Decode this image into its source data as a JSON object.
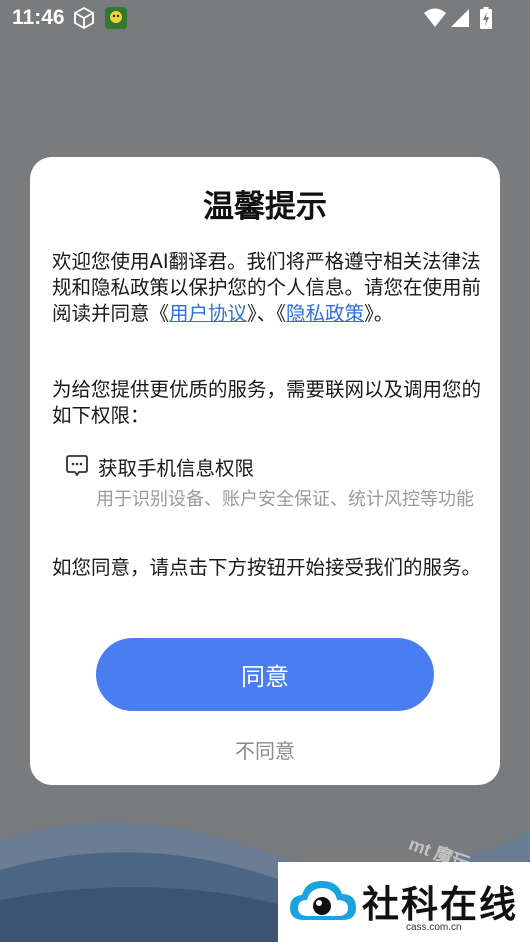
{
  "status_bar": {
    "time": "11:46"
  },
  "dialog": {
    "title": "温馨提示",
    "p1_text_a": "欢迎您使用AI翻译君。我们将严格遵守相关法律法规和隐私政策以保护您的个人信息。请您在使用前阅读并同意《",
    "user_agreement_link": "用户协议",
    "p1_text_b": "》、《",
    "privacy_policy_link": "隐私政策",
    "p1_text_c": "》。",
    "p2_text": "为给您提供更优质的服务，需要联网以及调用您的如下权限：",
    "permission": {
      "icon": "message-icon",
      "title": "获取手机信息权限",
      "description": "用于识别设备、账户安全保证、统计风控等功能"
    },
    "p4_text": "如您同意，请点击下方按钮开始接受我们的服务。",
    "agree_label": "同意",
    "disagree_label": "不同意"
  },
  "watermark": {
    "faint_text": "mt 魔玩",
    "title": "社科在线",
    "subtitle": "cass.com.cn"
  },
  "colors": {
    "accent": "#4a7df0",
    "link": "#2f6fe4",
    "overlay": "#7a7b7d"
  }
}
